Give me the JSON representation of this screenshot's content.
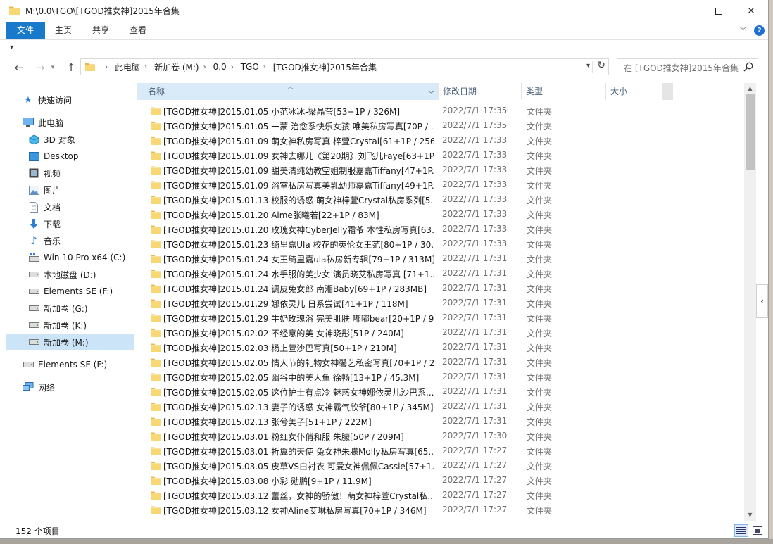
{
  "window": {
    "title": "M:\\0.0\\TGO\\[TGOD推女神]2015年合集",
    "colors": {
      "accent": "#1979ca",
      "folder": "#f8d775",
      "selected": "#cce4f7"
    }
  },
  "ribbon": {
    "tabs": [
      "文件",
      "主页",
      "共享",
      "查看"
    ]
  },
  "address": {
    "crumbs": [
      "此电脑",
      "新加卷 (M:)",
      "0.0",
      "TGO",
      "[TGOD推女神]2015年合集"
    ],
    "search_placeholder": "在 [TGOD推女神]2015年合集 中搜索"
  },
  "nav_pane": [
    {
      "label": "快速访问",
      "icon": "star-icon"
    },
    {
      "label": "此电脑",
      "icon": "computer-icon"
    },
    {
      "label": "3D 对象",
      "icon": "cube-icon"
    },
    {
      "label": "Desktop",
      "icon": "desktop-icon"
    },
    {
      "label": "视频",
      "icon": "video-icon"
    },
    {
      "label": "图片",
      "icon": "picture-icon"
    },
    {
      "label": "文档",
      "icon": "document-icon"
    },
    {
      "label": "下载",
      "icon": "download-icon"
    },
    {
      "label": "音乐",
      "icon": "music-icon"
    },
    {
      "label": "Win 10 Pro x64 (C:)",
      "icon": "drive-icon"
    },
    {
      "label": "本地磁盘 (D:)",
      "icon": "drive-icon"
    },
    {
      "label": "Elements SE (F:)",
      "icon": "drive-icon"
    },
    {
      "label": "新加卷 (G:)",
      "icon": "drive-icon"
    },
    {
      "label": "新加卷 (K:)",
      "icon": "drive-icon"
    },
    {
      "label": "新加卷 (M:)",
      "icon": "drive-icon"
    },
    {
      "label": "Elements SE (F:)",
      "icon": "drive-icon"
    },
    {
      "label": "网络",
      "icon": "network-icon"
    }
  ],
  "columns": {
    "name": "名称",
    "date": "修改日期",
    "type": "类型",
    "size": "大小"
  },
  "files": [
    {
      "name": "[TGOD推女神]2015.01.05 小范冰冰-梁晶莹[53+1P / 326M]",
      "date": "2022/7/1 17:35",
      "type": "文件夹"
    },
    {
      "name": "[TGOD推女神]2015.01.05 一蒙 治愈系快乐女孩 唯美私房写真[70P / ...",
      "date": "2022/7/1 17:35",
      "type": "文件夹"
    },
    {
      "name": "[TGOD推女神]2015.01.09 萌女神私房写真 梓萱Crystal[61+1P / 256...",
      "date": "2022/7/1 17:33",
      "type": "文件夹"
    },
    {
      "name": "[TGOD推女神]2015.01.09 女神去哪儿《第20期》刘飞儿Faye[63+1P...",
      "date": "2022/7/1 17:33",
      "type": "文件夹"
    },
    {
      "name": "[TGOD推女神]2015.01.09 甜美清纯幼教空姐制服嘉嘉Tiffany[47+1P...",
      "date": "2022/7/1 17:33",
      "type": "文件夹"
    },
    {
      "name": "[TGOD推女神]2015.01.09 浴室私房写真美乳幼师嘉嘉Tiffany[49+1P...",
      "date": "2022/7/1 17:33",
      "type": "文件夹"
    },
    {
      "name": "[TGOD推女神]2015.01.13 校服的诱惑 萌女神梓萱Crystal私房系列[5...",
      "date": "2022/7/1 17:33",
      "type": "文件夹"
    },
    {
      "name": "[TGOD推女神]2015.01.20 Aime张曦若[22+1P / 83M]",
      "date": "2022/7/1 17:33",
      "type": "文件夹"
    },
    {
      "name": "[TGOD推女神]2015.01.20 玫瑰女神CyberJelly霜爷 本性私房写真[63...",
      "date": "2022/7/1 17:33",
      "type": "文件夹"
    },
    {
      "name": "[TGOD推女神]2015.01.23 绮里嘉Ula 校花的英伦女王范[80+1P / 30...",
      "date": "2022/7/1 17:33",
      "type": "文件夹"
    },
    {
      "name": "[TGOD推女神]2015.01.24 女王绮里嘉ula私房新专辑[79+1P / 313M]",
      "date": "2022/7/1 17:31",
      "type": "文件夹"
    },
    {
      "name": "[TGOD推女神]2015.01.24 水手服的美少女 演员晓艾私房写真 [71+1...",
      "date": "2022/7/1 17:31",
      "type": "文件夹"
    },
    {
      "name": "[TGOD推女神]2015.01.24 调皮兔女郎 南湘Baby[69+1P / 283MB]",
      "date": "2022/7/1 17:31",
      "type": "文件夹"
    },
    {
      "name": "[TGOD推女神]2015.01.29 娜依灵儿 日系尝试[41+1P / 118M]",
      "date": "2022/7/1 17:31",
      "type": "文件夹"
    },
    {
      "name": "[TGOD推女神]2015.01.29 牛奶玫瑰浴 完美肌肤 嘟嘟bear[20+1P / 9...",
      "date": "2022/7/1 17:31",
      "type": "文件夹"
    },
    {
      "name": "[TGOD推女神]2015.02.02 不经意的美 女神晓彤[51P / 240M]",
      "date": "2022/7/1 17:31",
      "type": "文件夹"
    },
    {
      "name": "[TGOD推女神]2015.02.03 杨上萱沙巴写真[50+1P / 210M]",
      "date": "2022/7/1 17:31",
      "type": "文件夹"
    },
    {
      "name": "[TGOD推女神]2015.02.05 情人节的礼物女神馨艺私密写真[70+1P / 2...",
      "date": "2022/7/1 17:31",
      "type": "文件夹"
    },
    {
      "name": "[TGOD推女神]2015.02.05 幽谷中的美人鱼 徐畅[13+1P / 45.3M]",
      "date": "2022/7/1 17:31",
      "type": "文件夹"
    },
    {
      "name": "[TGOD推女神]2015.02.05 这位护士有点冷 魅惑女神娜依灵儿沙巴系...",
      "date": "2022/7/1 17:31",
      "type": "文件夹"
    },
    {
      "name": "[TGOD推女神]2015.02.13 妻子的诱惑 女神霸气欣爷[80+1P / 345M]",
      "date": "2022/7/1 17:31",
      "type": "文件夹"
    },
    {
      "name": "[TGOD推女神]2015.02.13 张兮美子[51+1P / 222M]",
      "date": "2022/7/1 17:31",
      "type": "文件夹"
    },
    {
      "name": "[TGOD推女神]2015.03.01 粉红女仆俏和服 朱朦[50P / 209M]",
      "date": "2022/7/1 17:30",
      "type": "文件夹"
    },
    {
      "name": "[TGOD推女神]2015.03.01 折翼的天使 兔女神朱朦Molly私房写真[65...",
      "date": "2022/7/1 17:27",
      "type": "文件夹"
    },
    {
      "name": "[TGOD推女神]2015.03.05 皮草VS白衬衣 可爱女神佩佩Cassie[57+1...",
      "date": "2022/7/1 17:27",
      "type": "文件夹"
    },
    {
      "name": "[TGOD推女神]2015.03.08 小彩 勋鹏[9+1P / 11.9M]",
      "date": "2022/7/1 17:27",
      "type": "文件夹"
    },
    {
      "name": "[TGOD推女神]2015.03.12 蕾丝，女神的骄傲！萌女神梓萱Crystal私...",
      "date": "2022/7/1 17:27",
      "type": "文件夹"
    },
    {
      "name": "[TGOD推女神]2015.03.12 女神Aline艾琳私房写真[70+1P / 346M]",
      "date": "2022/7/1 17:27",
      "type": "文件夹"
    }
  ],
  "status": {
    "count": "152 个项目"
  }
}
